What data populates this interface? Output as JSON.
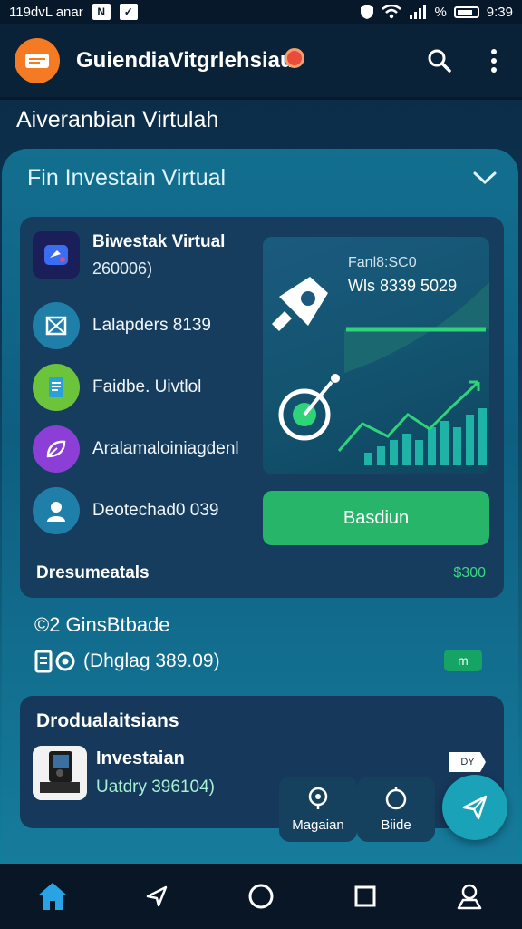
{
  "status_bar": {
    "left_text": "119dvL anar",
    "right_text": "9:39",
    "signal_text": "%"
  },
  "app_bar": {
    "title": "GuiendiaVitgrlehsiaui"
  },
  "section_heading": "Aiveranbian Virtulah",
  "card": {
    "header": "Fin Investain Virtual",
    "items": [
      {
        "title": "Biwestak Virtual",
        "subtitle": "260006)"
      },
      {
        "label": "Lalapders 8139"
      },
      {
        "label": "Faidbe. Uivtlol"
      },
      {
        "label": "Aralamaloiniagdenl"
      },
      {
        "label": "Deotechad0 039"
      }
    ],
    "chart": {
      "label_top": "Fanl8:SC0",
      "label_value": "Wls 8339 5029",
      "bars": [
        2,
        3,
        4,
        5,
        4,
        6,
        7,
        6,
        8,
        9
      ]
    },
    "primary_button": "Basdiun",
    "footer_left": "Dresumeatals",
    "footer_right": "$300"
  },
  "row_gins": "©2 GinsBtbade",
  "row_dhglag": {
    "text": "(Dhglag 389.09)",
    "badge": "m"
  },
  "bottom_panel": {
    "title": "Drodualaitsians",
    "item_title": "Investaian",
    "item_subtitle": "Uatdry 396104)",
    "tag": "DY"
  },
  "chips": [
    {
      "label": "Magaian"
    },
    {
      "label": "Biide"
    }
  ],
  "colors": {
    "accent_green": "#27b56a",
    "brand_orange": "#f47a24",
    "fab_teal": "#1aa3b8"
  }
}
